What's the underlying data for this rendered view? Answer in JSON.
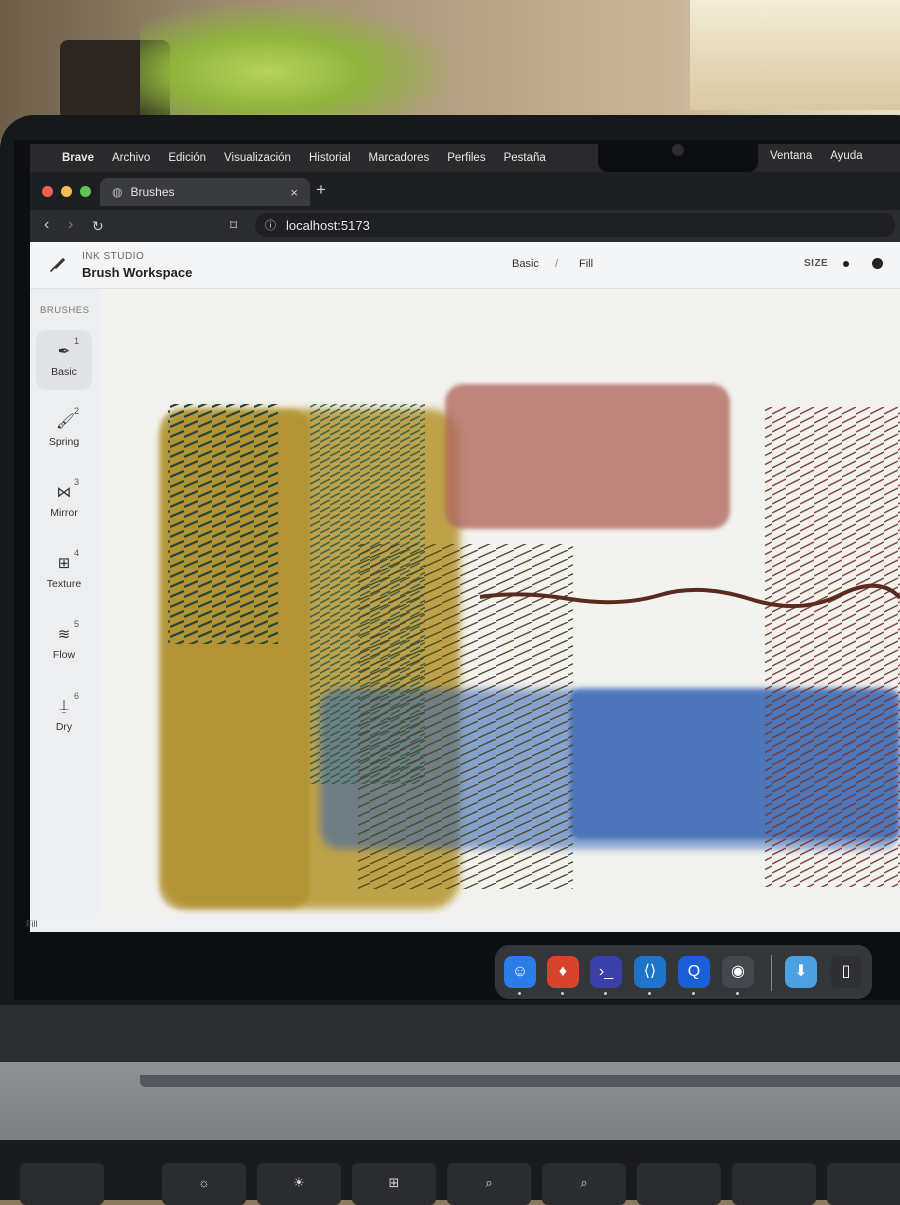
{
  "menubar": {
    "items": [
      "Brave",
      "Archivo",
      "Edición",
      "Visualización",
      "Historial",
      "Marcadores",
      "Perfiles",
      "Pestaña"
    ],
    "items_right": [
      "Ventana",
      "Ayuda"
    ]
  },
  "browser": {
    "tab_title": "Brushes",
    "new_tab_symbol": "+",
    "close_symbol": "×",
    "url": "localhost:5173"
  },
  "app": {
    "studio_label": "INK STUDIO",
    "workspace_title": "Brush Workspace",
    "breadcrumb": [
      "Basic",
      "/",
      "Fill"
    ],
    "size_label": "SIZE",
    "brushes_label": "BRUSHES",
    "brushes": [
      {
        "num": "1",
        "name": "Basic",
        "icon": "pen-nib-icon",
        "active": true
      },
      {
        "num": "2",
        "name": "Spring",
        "icon": "brush-icon",
        "active": false
      },
      {
        "num": "3",
        "name": "Mirror",
        "icon": "mirror-icon",
        "active": false
      },
      {
        "num": "4",
        "name": "Texture",
        "icon": "grid-icon",
        "active": false
      },
      {
        "num": "5",
        "name": "Flow",
        "icon": "waves-icon",
        "active": false
      },
      {
        "num": "6",
        "name": "Dry",
        "icon": "dry-brush-icon",
        "active": false
      }
    ],
    "status": "Fill"
  },
  "dock": {
    "apps": [
      "finder-icon",
      "brave-icon",
      "terminal-icon",
      "vscode-icon",
      "quicktime-icon",
      "disk-utility-icon"
    ],
    "folders": [
      "downloads-icon",
      "trash-icon"
    ]
  },
  "keyboard": {
    "keys": [
      "☼",
      "☀",
      "⊞",
      "⌕",
      "⌕"
    ]
  },
  "colors": {
    "ochre": "#b6952f",
    "teal": "#2f5a4a",
    "rose": "#b06a5e",
    "blue": "#2f62b5",
    "brown": "#6e3226"
  }
}
